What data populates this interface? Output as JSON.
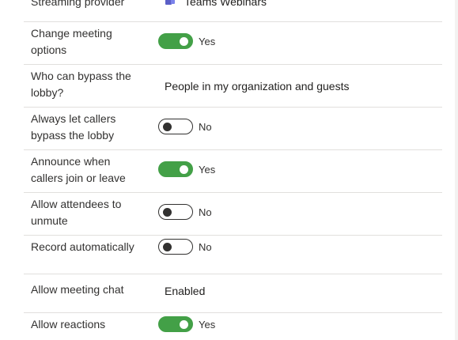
{
  "settings": [
    {
      "label": "Streaming provider",
      "value": "Teams Webinars",
      "icon": "teams-icon"
    },
    {
      "label": "Change meeting options",
      "state": "Yes",
      "on": true
    },
    {
      "label": "Who can bypass the lobby?",
      "value": "People in my organization and guests"
    },
    {
      "label": "Always let callers bypass the lobby",
      "state": "No",
      "on": false
    },
    {
      "label": "Announce when callers join or leave",
      "state": "Yes",
      "on": true
    },
    {
      "label": "Allow attendees to unmute",
      "state": "No",
      "on": false
    },
    {
      "label": "Record automatically",
      "state": "No",
      "on": false
    },
    {
      "label": "Allow meeting chat",
      "value": "Enabled"
    },
    {
      "label": "Allow reactions",
      "state": "Yes",
      "on": true
    }
  ],
  "colors": {
    "toggle_on": "#43a047",
    "toggle_off_border": "#323130",
    "divider": "#e1dfdd"
  }
}
